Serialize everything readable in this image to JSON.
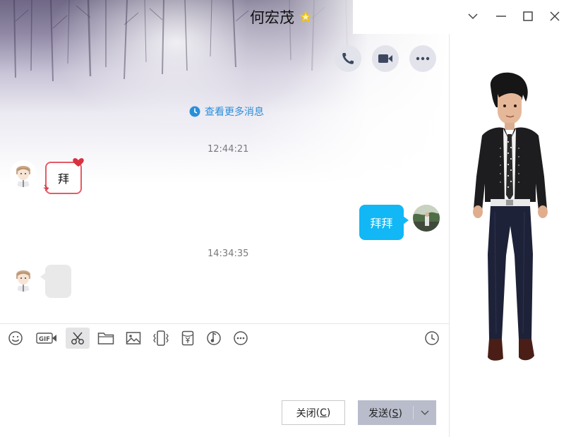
{
  "window": {
    "title": "何宏茂",
    "title_icon": "star-badge-icon"
  },
  "header_actions": [
    "phone-icon",
    "video-call-icon",
    "more-icon"
  ],
  "chat": {
    "view_more_label": "查看更多消息",
    "messages": [
      {
        "timestamp": "12:44:21"
      },
      {
        "side": "left",
        "text": "拜",
        "style": "heart-bubble"
      },
      {
        "side": "right",
        "text": "拜拜"
      },
      {
        "timestamp": "14:34:35"
      },
      {
        "side": "left",
        "text": "",
        "style": "empty-bubble"
      }
    ]
  },
  "toolbar": {
    "items": [
      "emoji-icon",
      "gif-icon",
      "scissors-icon",
      "folder-icon",
      "image-icon",
      "shake-icon",
      "red-packet-icon",
      "music-icon",
      "more-icon",
      "history-icon"
    ]
  },
  "actions": {
    "close_label": "关闭",
    "close_shortcut": "C",
    "send_label": "发送",
    "send_shortcut": "S"
  },
  "colors": {
    "accent": "#12b7f5",
    "link": "#2a8fd9",
    "send_button": "#b9bccb",
    "star": "#f5c400"
  }
}
